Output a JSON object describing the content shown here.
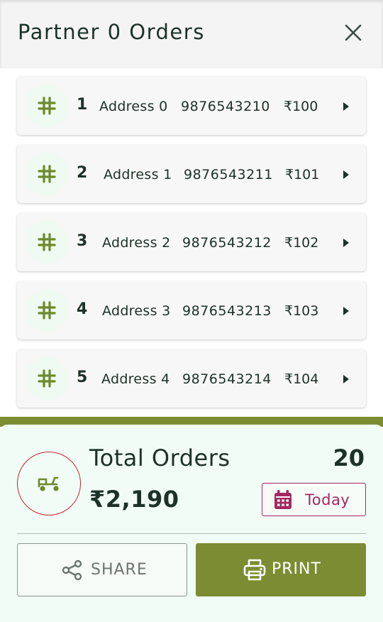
{
  "header": {
    "title": "Partner 0 Orders",
    "close_icon": "close-icon"
  },
  "orders": [
    {
      "num": "1",
      "address": "Address 0",
      "phone": "9876543210",
      "amount": "₹100"
    },
    {
      "num": "2",
      "address": "Address 1",
      "phone": "9876543211",
      "amount": "₹101"
    },
    {
      "num": "3",
      "address": "Address 2",
      "phone": "9876543212",
      "amount": "₹102"
    },
    {
      "num": "4",
      "address": "Address 3",
      "phone": "9876543213",
      "amount": "₹103"
    },
    {
      "num": "5",
      "address": "Address 4",
      "phone": "9876543214",
      "amount": "₹104"
    }
  ],
  "summary": {
    "total_label": "Total Orders",
    "total_amount": "₹2,190",
    "total_count": "20",
    "date_filter": "Today"
  },
  "actions": {
    "share_label": "SHARE",
    "print_label": "PRINT"
  },
  "colors": {
    "accent": "#7b8c33",
    "hash_icon": "#6b8a2a",
    "date_accent": "#a3285f",
    "scooter_ring": "#c0272d",
    "panel_bg": "#f2fcf7"
  },
  "icons": {
    "row": "hash-icon",
    "row_action": "caret-right-icon",
    "delivery": "scooter-icon",
    "date": "calendar-icon",
    "share": "share-icon",
    "print": "printer-icon"
  }
}
